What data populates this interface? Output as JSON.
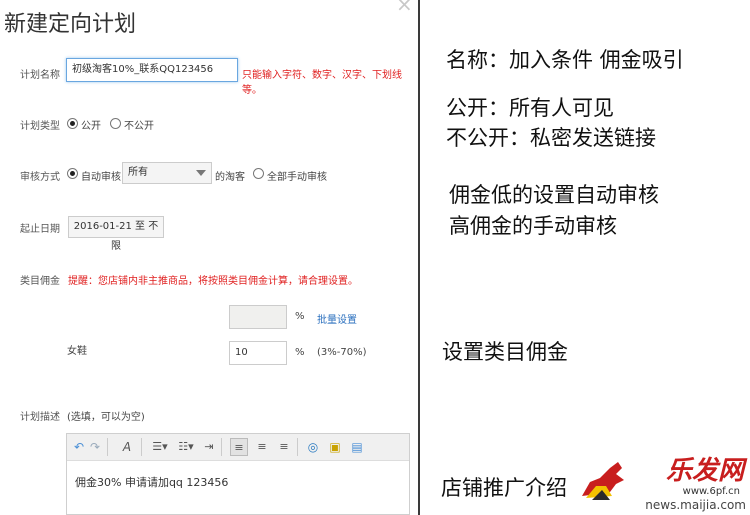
{
  "dialog": {
    "title": "新建定向计划",
    "close": "×",
    "name": {
      "label": "计划名称",
      "value": "初级淘客10%_联系QQ123456",
      "warning": "只能输入字符、数字、汉字、下划线等。"
    },
    "type": {
      "label": "计划类型",
      "public": "公开",
      "private": "不公开",
      "selected": "公开"
    },
    "review": {
      "label": "审核方式",
      "auto": "自动审核",
      "select_value": "所有",
      "suffix": "的淘客",
      "manual": "全部手动审核",
      "selected": "自动审核"
    },
    "dates": {
      "label": "起止日期",
      "value": "2016-01-21 至 不限"
    },
    "category": {
      "label": "类目佣金",
      "notice": "提醒：您店铺内非主推商品，将按照类目佣金计算，请合理设置。",
      "batch_value": "",
      "batch_unit": "%",
      "batch_link": "批量设置",
      "item_name": "女鞋",
      "item_value": "10",
      "item_unit": "%",
      "item_range": "(3%-70%)"
    },
    "description": {
      "label": "计划描述",
      "hint": "(选填，可以为空)",
      "content": "佣金30% 申请请加qq 123456"
    }
  },
  "notes": {
    "n1": "名称：加入条件 佣金吸引",
    "n2": "公开：所有人可见",
    "n3": "不公开：私密发送链接",
    "n4": "佣金低的设置自动审核",
    "n5": "高佣金的手动审核",
    "n6": "设置类目佣金",
    "n7_part1": "店铺推广介",
    "n7_part2": "绍"
  },
  "watermark": {
    "logo": "乐发网",
    "url1": "www.6pf.cn",
    "url2": "news.maijia.com"
  },
  "colors": {
    "warning": "#e02020",
    "link": "#2a6fbe",
    "focus_border": "#6aa7e0"
  }
}
